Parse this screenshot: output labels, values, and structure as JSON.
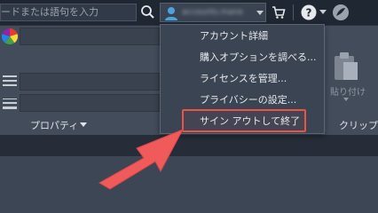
{
  "search": {
    "placeholder": "ードまたは語句を入力"
  },
  "account": {
    "name": "accounts.mane"
  },
  "ribbon": {
    "properties_label": "プロパティ",
    "paste_label": "貼り付け",
    "clipboard_label": "クリップボ"
  },
  "account_menu": {
    "items": [
      {
        "label": "アカウント詳細"
      },
      {
        "label": "購入オプションを調べる..."
      },
      {
        "label": "ライセンスを管理..."
      },
      {
        "label": "プライバシーの設定..."
      },
      {
        "label": "サイン アウトして終了"
      }
    ],
    "highlighted_index": 4
  },
  "colors": {
    "topbar": "#1f2733",
    "ribbon": "#434c5b",
    "menu": "#3b4453",
    "highlight": "#e8534a",
    "account_icon": "#4aa3df"
  }
}
